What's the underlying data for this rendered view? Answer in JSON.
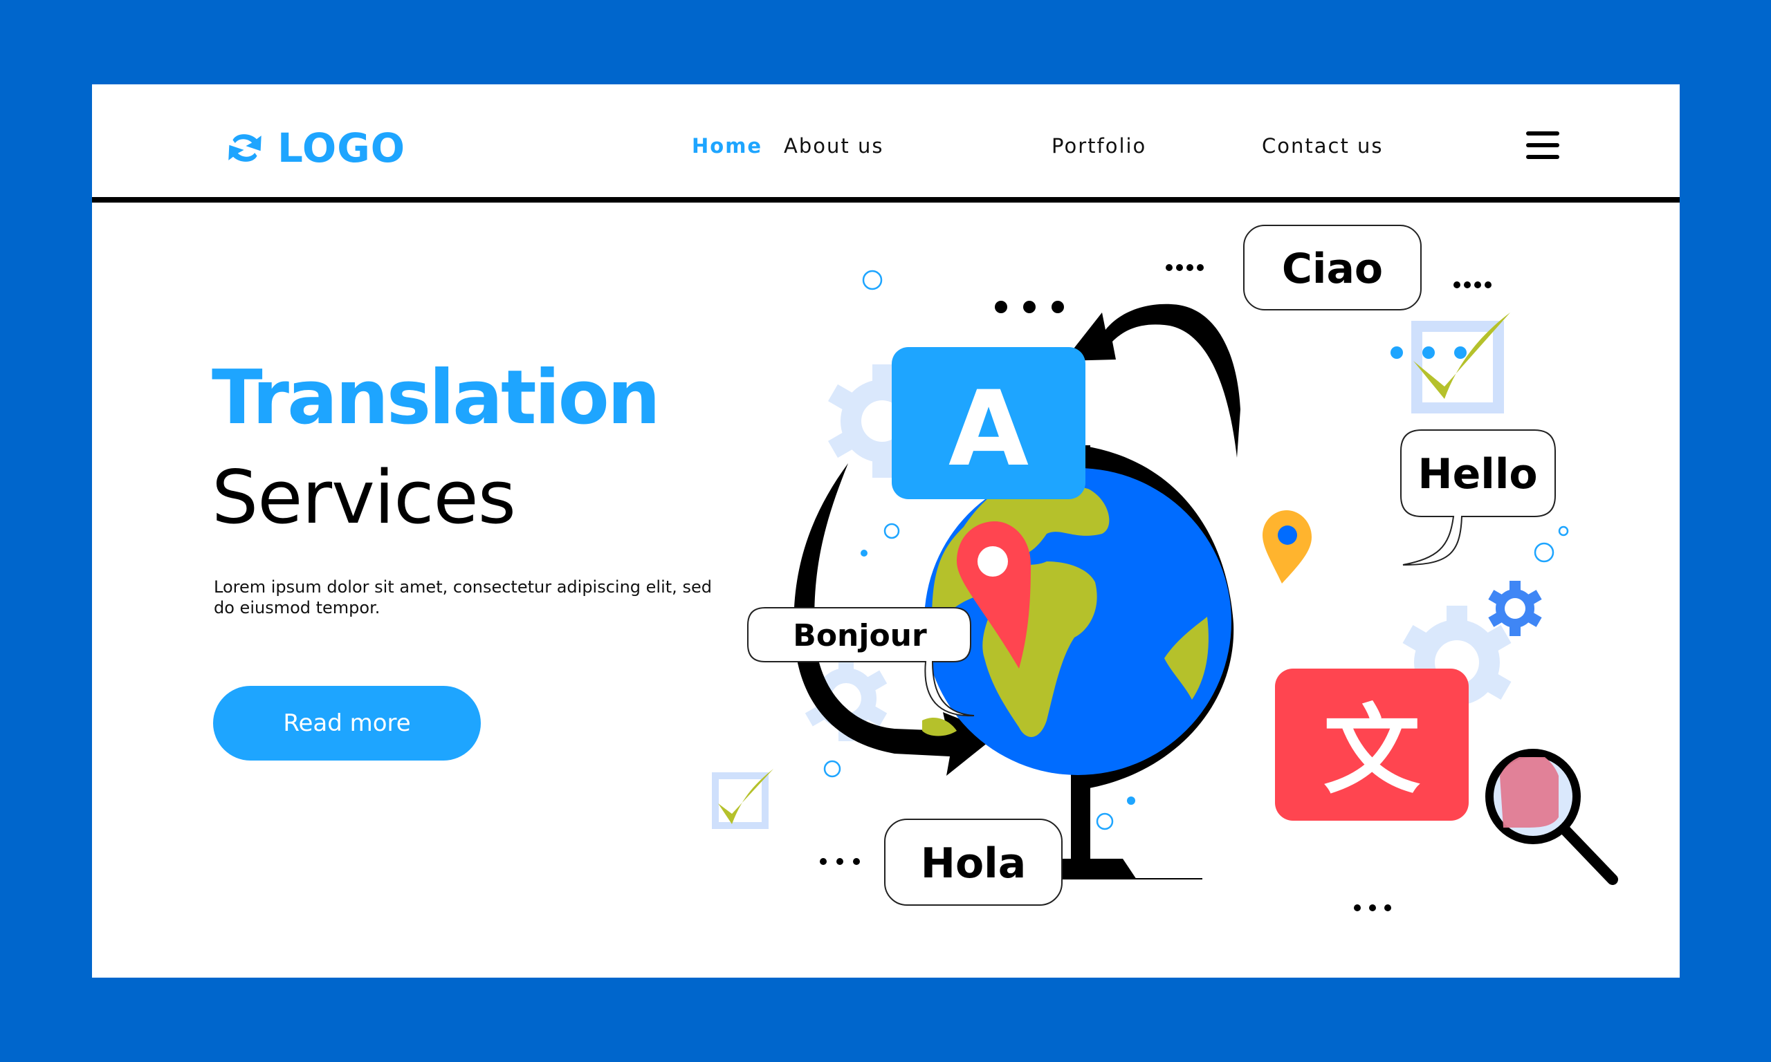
{
  "header": {
    "logo_text": "LOGO",
    "logo_icon": "sync-arrows-icon",
    "nav": [
      {
        "label": "Home",
        "active": true
      },
      {
        "label": "About us",
        "active": false
      },
      {
        "label": "Portfolio",
        "active": false
      },
      {
        "label": "Contact us",
        "active": false
      }
    ],
    "menu_icon": "hamburger-menu-icon"
  },
  "hero": {
    "title_line1": "Translation",
    "title_line2": "Services",
    "description": "Lorem ipsum dolor sit amet, consectetur adipiscing elit, sed do eiusmod tempor.",
    "cta_label": "Read more"
  },
  "illustration": {
    "letter_card": "A",
    "glyph_card": "文",
    "bubbles": [
      "Ciao",
      "Hello",
      "Bonjour",
      "Hola"
    ],
    "icons": [
      "globe-icon",
      "location-pin-icon",
      "magnifier-icon",
      "gear-icon",
      "checkbox-icon",
      "curved-arrow-icon"
    ]
  },
  "colors": {
    "frame": "#0066cc",
    "accent": "#1ea5ff",
    "globe_ocean": "#006cff",
    "globe_land": "#b5c12b",
    "pin_red": "#ff4550",
    "pin_orange": "#ffb42e",
    "gear_light": "#dae8fc",
    "gear_blue": "#3f86f5"
  }
}
